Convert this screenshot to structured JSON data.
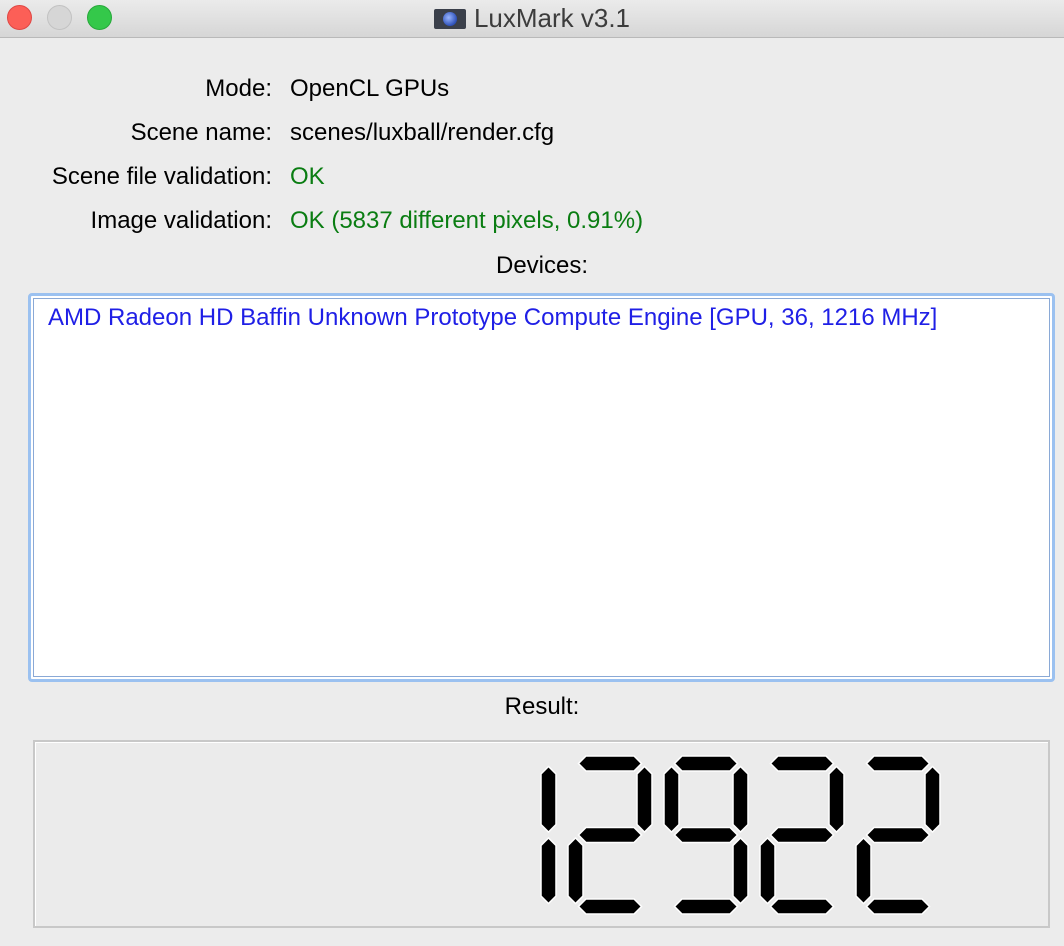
{
  "window": {
    "title": "LuxMark v3.1",
    "app_icon": "luxball-icon",
    "controls": [
      "close",
      "minimize",
      "maximize"
    ]
  },
  "info": {
    "mode_label": "Mode:",
    "mode_value": "OpenCL GPUs",
    "scene_label": "Scene name:",
    "scene_value": "scenes/luxball/render.cfg",
    "scene_validation_label": "Scene file validation:",
    "scene_validation_value": "OK",
    "image_validation_label": "Image validation:",
    "image_validation_value": "OK (5837 different pixels, 0.91%)"
  },
  "devices": {
    "label": "Devices:",
    "items": [
      "AMD Radeon HD Baffin Unknown Prototype Compute Engine [GPU, 36, 1216 MHz]"
    ]
  },
  "result": {
    "label": "Result:",
    "score": "12922"
  },
  "colors": {
    "ok": "#0a7d12",
    "device_text": "#1f1fe6",
    "focus_ring": "#9bc1f0",
    "lcd_segment": "#000000"
  }
}
